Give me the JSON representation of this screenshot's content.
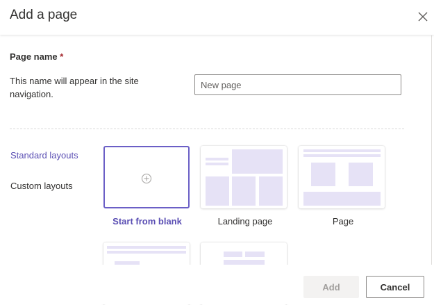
{
  "dialog": {
    "title": "Add a page",
    "close_icon": "close-icon"
  },
  "page_name": {
    "label": "Page name",
    "required_marker": "*",
    "description": "This name will appear in the site navigation.",
    "placeholder": "New page",
    "value": ""
  },
  "layout_nav": {
    "items": [
      {
        "label": "Standard layouts",
        "selected": true
      },
      {
        "label": "Custom layouts",
        "selected": false
      }
    ]
  },
  "layouts": [
    {
      "label": "Start from blank",
      "icon": "plus-circle-icon",
      "selected": true
    },
    {
      "label": "Landing page",
      "selected": false
    },
    {
      "label": "Page",
      "selected": false
    }
  ],
  "footer": {
    "add_label": "Add",
    "add_disabled": true,
    "cancel_label": "Cancel"
  },
  "colors": {
    "accent": "#5b4fb4",
    "placeholder_block": "#e6e2f6",
    "required": "#a4262c"
  }
}
